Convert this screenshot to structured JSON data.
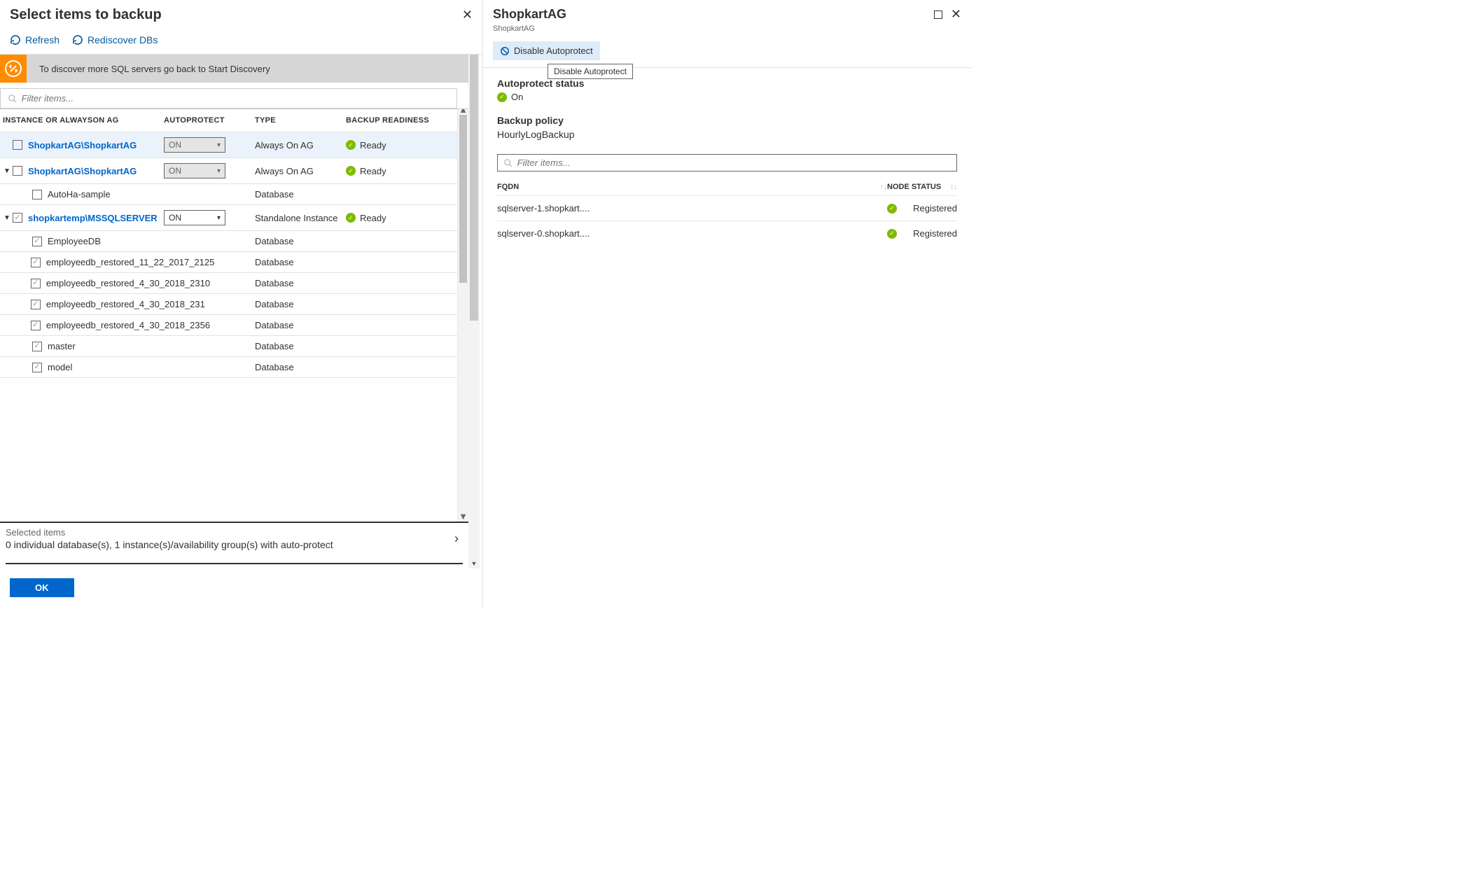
{
  "main": {
    "title": "Select items to backup",
    "toolbar": {
      "refresh": "Refresh",
      "rediscover": "Rediscover DBs"
    },
    "info": "To discover more SQL servers go back to Start Discovery",
    "filter_placeholder": "Filter items...",
    "columns": {
      "instance": "INSTANCE OR ALWAYSON AG",
      "auto": "AUTOPROTECT",
      "type": "TYPE",
      "ready": "BACKUP READINESS"
    },
    "rows": [
      {
        "caret": "",
        "checked": false,
        "label": "ShopkartAG\\ShopkartAG",
        "link": true,
        "auto": "ON",
        "auto_disabled": true,
        "type": "Always On AG",
        "ready": "Ready",
        "highlighted": true,
        "child": false
      },
      {
        "caret": "down",
        "checked": false,
        "label": "ShopkartAG\\ShopkartAG",
        "link": true,
        "auto": "ON",
        "auto_disabled": true,
        "type": "Always On AG",
        "ready": "Ready",
        "child": false
      },
      {
        "caret": "",
        "checked": false,
        "label": "AutoHa-sample",
        "link": false,
        "auto": "",
        "type": "Database",
        "ready": "",
        "child": true
      },
      {
        "caret": "down",
        "checked": true,
        "label": "shopkartemp\\MSSQLSERVER",
        "link": true,
        "auto": "ON",
        "auto_disabled": false,
        "type": "Standalone Instance",
        "ready": "Ready",
        "child": false
      },
      {
        "caret": "",
        "checked": true,
        "label": "EmployeeDB",
        "link": false,
        "auto": "",
        "type": "Database",
        "ready": "",
        "child": true
      },
      {
        "caret": "",
        "checked": true,
        "label": "employeedb_restored_11_22_2017_2125",
        "link": false,
        "auto": "",
        "type": "Database",
        "ready": "",
        "child": true
      },
      {
        "caret": "",
        "checked": true,
        "label": "employeedb_restored_4_30_2018_2310",
        "link": false,
        "auto": "",
        "type": "Database",
        "ready": "",
        "child": true
      },
      {
        "caret": "",
        "checked": true,
        "label": "employeedb_restored_4_30_2018_231",
        "link": false,
        "auto": "",
        "type": "Database",
        "ready": "",
        "child": true
      },
      {
        "caret": "",
        "checked": true,
        "label": "employeedb_restored_4_30_2018_2356",
        "link": false,
        "auto": "",
        "type": "Database",
        "ready": "",
        "child": true
      },
      {
        "caret": "",
        "checked": true,
        "label": "master",
        "link": false,
        "auto": "",
        "type": "Database",
        "ready": "",
        "child": true
      },
      {
        "caret": "",
        "checked": true,
        "label": "model",
        "link": false,
        "auto": "",
        "type": "Database",
        "ready": "",
        "child": true
      }
    ],
    "footer": {
      "label": "Selected items",
      "desc": "0 individual database(s), 1 instance(s)/availability group(s) with auto-protect"
    },
    "ok": "OK"
  },
  "right": {
    "title": "ShopkartAG",
    "subtitle": "ShopkartAG",
    "disable": "Disable Autoprotect",
    "tooltip": "Disable Autoprotect",
    "status_label": "Autoprotect status",
    "status_value": "On",
    "policy_label": "Backup policy",
    "policy_value": "HourlyLogBackup",
    "filter_placeholder": "Filter items...",
    "columns": {
      "fqdn": "FQDN",
      "node": "NODE STATUS"
    },
    "nodes": [
      {
        "fqdn": "sqlserver-1.shopkart....",
        "status": "Registered"
      },
      {
        "fqdn": "sqlserver-0.shopkart....",
        "status": "Registered"
      }
    ]
  }
}
